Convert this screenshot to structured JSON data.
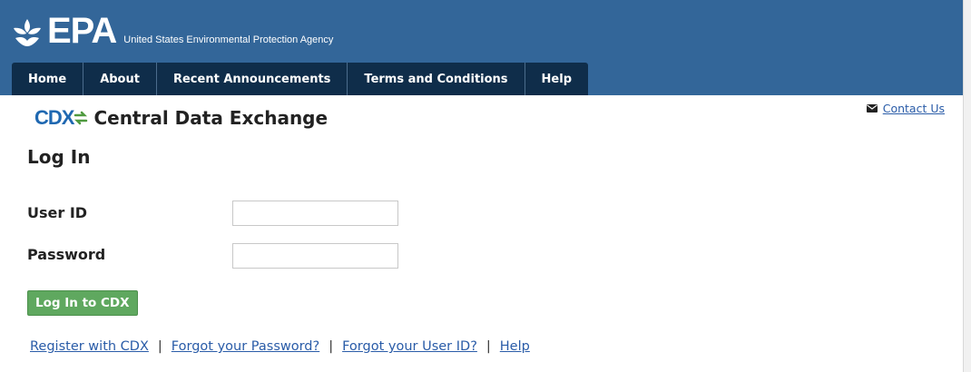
{
  "header": {
    "logo_text": "EPA",
    "agency_name": "United States Environmental Protection Agency",
    "colors": {
      "header_bg": "#336699",
      "nav_bg": "#0f2d4a"
    }
  },
  "nav": {
    "items": [
      {
        "label": "Home"
      },
      {
        "label": "About"
      },
      {
        "label": "Recent Announcements"
      },
      {
        "label": "Terms and Conditions"
      },
      {
        "label": "Help"
      }
    ]
  },
  "contact": {
    "icon": "envelope-icon",
    "label": "Contact Us"
  },
  "app": {
    "logo_mark": "CDX",
    "title": "Central Data Exchange"
  },
  "login": {
    "heading": "Log In",
    "user_id_label": "User ID",
    "user_id_value": "",
    "password_label": "Password",
    "password_value": "",
    "submit_label": "Log In to CDX",
    "submit_color": "#5fa85f"
  },
  "links": {
    "register": "Register with CDX",
    "forgot_password": "Forgot your Password?",
    "forgot_user_id": "Forgot your User ID?",
    "help": "Help",
    "separator": "|"
  }
}
